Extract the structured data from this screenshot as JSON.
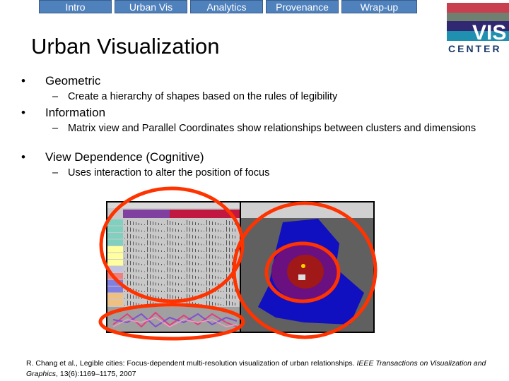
{
  "nav": {
    "tabs": [
      {
        "label": "Intro"
      },
      {
        "label": "Urban Vis"
      },
      {
        "label": "Analytics"
      },
      {
        "label": "Provenance"
      },
      {
        "label": "Wrap-up"
      }
    ]
  },
  "logo": {
    "text_top": "VIS",
    "text_bottom": "CENTER"
  },
  "title": "Urban Visualization",
  "bullets": [
    {
      "text": "Geometric",
      "sub": "Create a hierarchy of shapes based on the rules of legibility"
    },
    {
      "text": "Information",
      "sub": "Matrix view and Parallel Coordinates show relationships between clusters and dimensions"
    },
    {
      "text": "View Dependence (Cognitive)",
      "sub": "Uses interaction to alter the position of focus"
    }
  ],
  "citation": {
    "authors": "R. Chang et al., Legible cities: Focus-dependent multi-resolution visualization of urban relationships.",
    "journal": "IEEE Transactions on Visualization and Graphics",
    "details": ", 13(6):1169–1175, 2007"
  },
  "colors": {
    "tab": "#4f81bd",
    "highlight": "#ff3300",
    "map_blue": "#1010c0",
    "map_bg": "#606060"
  }
}
